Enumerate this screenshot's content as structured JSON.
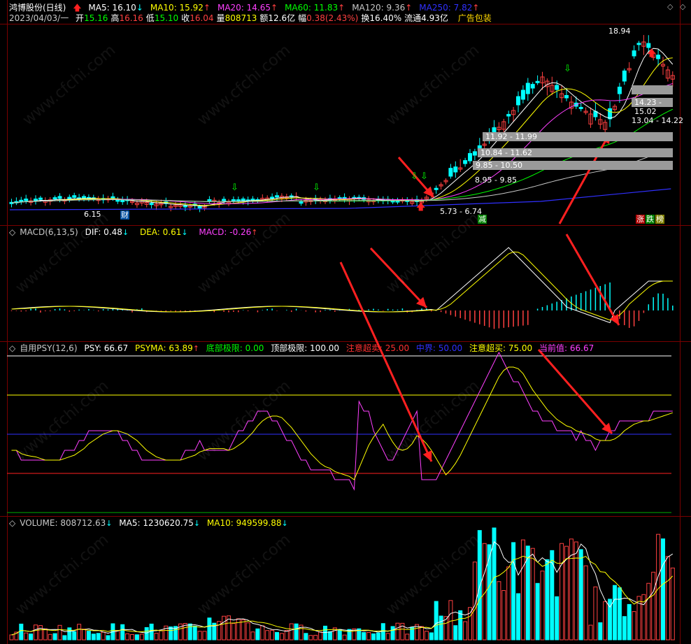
{
  "header": {
    "stock": "鸿博股份(日线)",
    "date": "2023/04/03/一",
    "ma": [
      {
        "label": "MA5: 16.10",
        "dir": "↓",
        "color": "#ffffff"
      },
      {
        "label": "MA10: 15.92",
        "dir": "↑",
        "color": "#ffff00"
      },
      {
        "label": "MA20: 14.65",
        "dir": "↑",
        "color": "#ff40ff"
      },
      {
        "label": "MA60: 11.83",
        "dir": "↑",
        "color": "#00ff00"
      },
      {
        "label": "MA120: 9.36",
        "dir": "↑",
        "color": "#c8c8c8"
      },
      {
        "label": "MA250: 7.82",
        "dir": "↑",
        "color": "#3030ff"
      }
    ],
    "quote": [
      {
        "k": "开",
        "v": "15.16",
        "color": "#00ff00"
      },
      {
        "k": "高",
        "v": "16.16",
        "color": "#ff4040"
      },
      {
        "k": "低",
        "v": "15.10",
        "color": "#00ff00"
      },
      {
        "k": "收",
        "v": "16.04",
        "color": "#ff4040"
      },
      {
        "k": "量",
        "v": "808713",
        "color": "#ffff00"
      },
      {
        "k": "额",
        "v": "12.6亿",
        "color": "#ffffff"
      },
      {
        "k": "幅",
        "v": "0.38(2.43%)",
        "color": "#ff4040"
      },
      {
        "k": "换",
        "v": "16.40%",
        "color": "#ffffff"
      },
      {
        "k": "流通",
        "v": "4.93亿",
        "color": "#ffffff"
      }
    ],
    "ad": "广告包装"
  },
  "price_labels": {
    "high": "18.94",
    "low": "6.15",
    "low2": "5.73 - 6.74",
    "zones": [
      "14.23 - 15.02",
      "13.04 - 14.22",
      "11.92 - 11.99",
      "10.84 - 11.62",
      "9.85 - 10.50",
      "8.95 - 9.85"
    ],
    "markers": {
      "cai": "财",
      "jian": "减",
      "zhang": "涨",
      "die": "跌",
      "bang": "榜"
    }
  },
  "macd": {
    "title": "MACD(6,13,5)",
    "dif": "DIF: 0.48",
    "dif_dir": "↓",
    "dea": "DEA: 0.61",
    "dea_dir": "↓",
    "macd": "MACD: -0.26",
    "macd_dir": "↑"
  },
  "psy": {
    "title": "自用PSY(12,6)",
    "psy": "PSY: 66.67",
    "psyma": "PSYMA: 63.89",
    "psyma_dir": "↑",
    "bottom": "底部极限: 0.00",
    "top": "顶部极限: 100.00",
    "oversold": "注意超卖: 25.00",
    "mid": "中界: 50.00",
    "overbought": "注意超买: 75.00",
    "current": "当前值: 66.67"
  },
  "volume": {
    "title": "VOLUME: 808712.63",
    "title_dir": "↓",
    "ma5": "MA5: 1230620.75",
    "ma5_dir": "↓",
    "ma10": "MA10: 949599.88",
    "ma10_dir": "↓"
  },
  "watermark": "www.cfchi.com",
  "colors": {
    "up": "#ff4040",
    "down": "#00ffff",
    "grid": "#7a0000"
  }
}
